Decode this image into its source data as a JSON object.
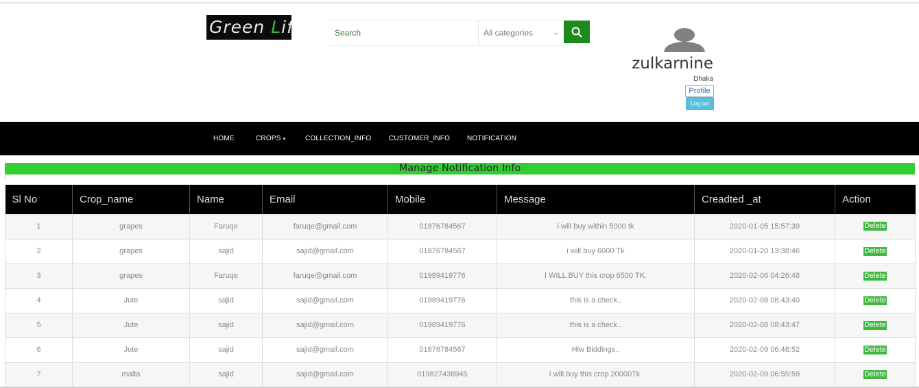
{
  "header": {
    "logo_part1": "Green ",
    "logo_accent": "L",
    "logo_part2": "ife",
    "search_placeholder": "Search",
    "category_selected": "All categories",
    "username": "zulkarnine",
    "city": "Dhaka",
    "profile_label": "Profile",
    "logout_label": "Log out"
  },
  "nav": {
    "items": [
      {
        "label": "HOME"
      },
      {
        "label": "CROPS"
      },
      {
        "label": "COLLECTION_INFO"
      },
      {
        "label": "CUSTOMER_INFO"
      },
      {
        "label": "NOTIFICATION"
      }
    ]
  },
  "page": {
    "title": "Manage Notification Info",
    "colon_mark": ":"
  },
  "table": {
    "headers": [
      "Sl No",
      "Crop_name",
      "Name",
      "Email",
      "Mobile",
      "Message",
      "Creadted _at",
      "Action"
    ],
    "rows": [
      {
        "sl": "1",
        "crop": "grapes",
        "name": "Faruqe",
        "email": "faruqe@gmail.com",
        "mobile": "01876784567",
        "message": "i will buy within 5000 tk",
        "created": "2020-01-05 15:57:39",
        "action": "Delete"
      },
      {
        "sl": "2",
        "crop": "grapes",
        "name": "sajid",
        "email": "sajid@gmail.com",
        "mobile": "01876784567",
        "message": "i will buy 6000 Tk",
        "created": "2020-01-20 13:38:46",
        "action": "Delete"
      },
      {
        "sl": "3",
        "crop": "grapes",
        "name": "Faruqe",
        "email": "faruqe@gmail.com",
        "mobile": "01989419776",
        "message": "I WILL BUY this crop 6500 TK.",
        "created": "2020-02-06 04:26:48",
        "action": "Delete"
      },
      {
        "sl": "4",
        "crop": "Jute",
        "name": "sajid",
        "email": "sajid@gmail.com",
        "mobile": "01989419776",
        "message": "this is a check..",
        "created": "2020-02-08 08:43:40",
        "action": "Delete"
      },
      {
        "sl": "5",
        "crop": "Jute",
        "name": "sajid",
        "email": "sajid@gmail.com",
        "mobile": "01989419776",
        "message": "this is a check..",
        "created": "2020-02-08 08:43:47",
        "action": "Delete"
      },
      {
        "sl": "6",
        "crop": "Jute",
        "name": "sajid",
        "email": "sajid@gmail.com",
        "mobile": "01876784567",
        "message": "Hlw Biddings..",
        "created": "2020-02-09 06:48:52",
        "action": "Delete"
      },
      {
        "sl": "7",
        "crop": "malta",
        "name": "sajid",
        "email": "sajid@gmail.com",
        "mobile": "019827438945",
        "message": "I will buy this crop 20000Tk.",
        "created": "2020-02-09 06:55:59",
        "action": "Delete"
      }
    ]
  },
  "colors": {
    "accent_green": "#32cd32",
    "search_button": "#1e8a1e",
    "navbar": "#000000",
    "logout_button": "#5bc0de"
  },
  "icons": {
    "search": "search-icon",
    "avatar": "user-avatar-icon",
    "dropdown": "chevron-down-icon",
    "crops_menu": "caret-down-icon"
  }
}
